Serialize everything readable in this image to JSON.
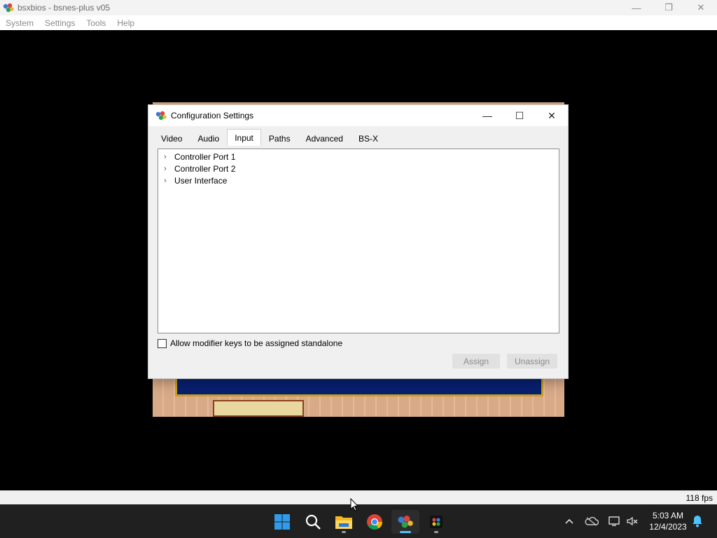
{
  "window": {
    "title": "bsxbios - bsnes-plus v05",
    "menu": [
      "System",
      "Settings",
      "Tools",
      "Help"
    ]
  },
  "dialog": {
    "title": "Configuration Settings",
    "tabs": [
      "Video",
      "Audio",
      "Input",
      "Paths",
      "Advanced",
      "BS-X"
    ],
    "active_tab": "Input",
    "tree": [
      "Controller Port 1",
      "Controller Port 2",
      "User Interface"
    ],
    "modifier_checkbox": {
      "label": "Allow modifier keys to be assigned standalone",
      "checked": false
    },
    "buttons": {
      "assign": "Assign",
      "unassign": "Unassign"
    }
  },
  "status": {
    "fps": "118 fps"
  },
  "taskbar": {
    "apps": [
      "start-icon",
      "search-icon",
      "file-explorer-icon",
      "chrome-icon",
      "bsnes-icon",
      "snes-app-icon"
    ],
    "clock_time": "5:03 AM",
    "clock_date": "12/4/2023"
  },
  "colors": {
    "accent": "#4cc2ff",
    "game_navy": "#082070",
    "game_wall": "#dcae8a"
  }
}
